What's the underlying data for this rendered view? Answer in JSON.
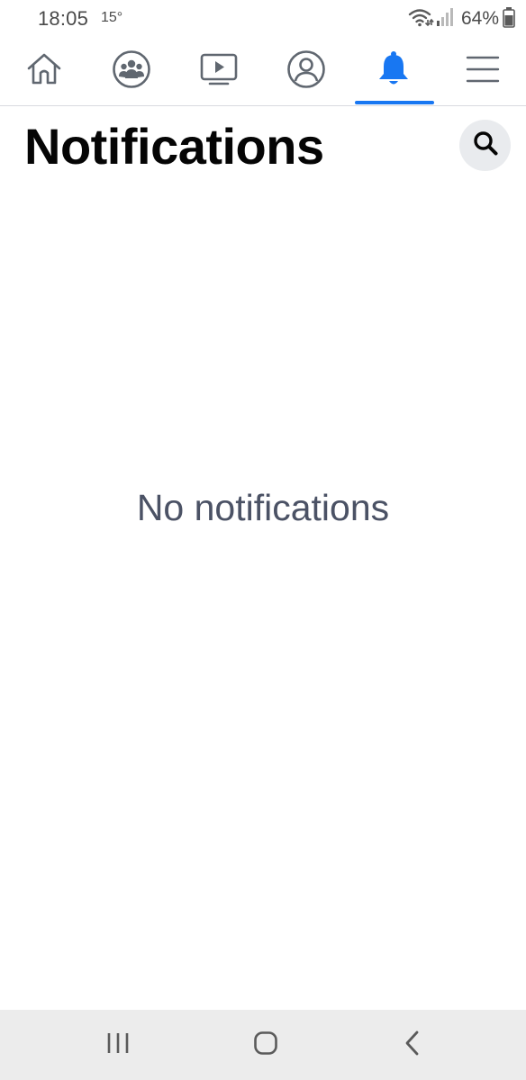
{
  "status_bar": {
    "time": "18:05",
    "temperature": "15°",
    "battery_percent": "64%",
    "icons": [
      "wifi-icon",
      "signal-icon",
      "battery-icon"
    ]
  },
  "tabs": [
    {
      "name": "home",
      "icon": "home-icon",
      "active": false
    },
    {
      "name": "groups",
      "icon": "groups-icon",
      "active": false
    },
    {
      "name": "watch",
      "icon": "video-icon",
      "active": false
    },
    {
      "name": "profile",
      "icon": "profile-icon",
      "active": false
    },
    {
      "name": "notifications",
      "icon": "bell-icon",
      "active": true
    },
    {
      "name": "menu",
      "icon": "menu-icon",
      "active": false
    }
  ],
  "header": {
    "title": "Notifications",
    "search_icon": "search-icon"
  },
  "main": {
    "empty_message": "No notifications"
  },
  "navigation_bar": {
    "buttons": [
      "recents-icon",
      "home-circle-icon",
      "back-icon"
    ]
  },
  "colors": {
    "accent": "#1877f2",
    "icon_gray": "#606770",
    "title": "#050505",
    "message": "#4b5265",
    "search_bg": "#e9ebee",
    "nav_bar_bg": "#ececec"
  }
}
